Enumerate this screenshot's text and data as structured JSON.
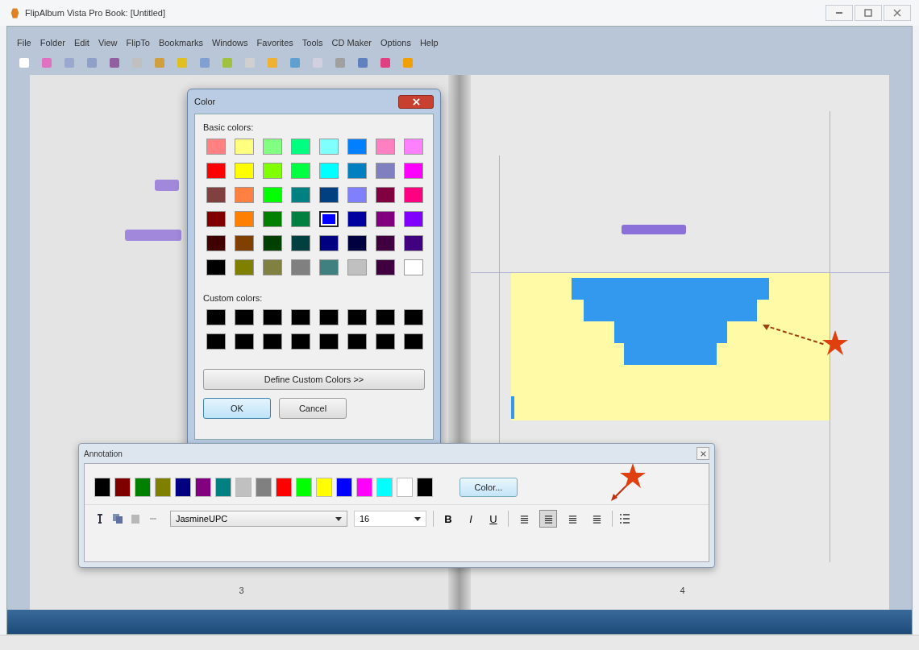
{
  "window": {
    "title": "FlipAlbum Vista Pro   Book: [Untitled]"
  },
  "menu": [
    "File",
    "Folder",
    "Edit",
    "View",
    "FlipTo",
    "Bookmarks",
    "Windows",
    "Favorites",
    "Tools",
    "CD Maker",
    "Options",
    "Help"
  ],
  "pages": {
    "left_number": "3",
    "right_number": "4"
  },
  "color_dialog": {
    "title": "Color",
    "basic_label": "Basic colors:",
    "custom_label": "Custom colors:",
    "define_button": "Define Custom Colors >>",
    "ok": "OK",
    "cancel": "Cancel",
    "basic_colors": [
      {
        "color": "#ff8080",
        "selected": false
      },
      {
        "color": "#ffff80",
        "selected": false
      },
      {
        "color": "#80ff80",
        "selected": false
      },
      {
        "color": "#00ff80",
        "selected": false
      },
      {
        "color": "#80ffff",
        "selected": false
      },
      {
        "color": "#0080ff",
        "selected": false
      },
      {
        "color": "#ff80c0",
        "selected": false
      },
      {
        "color": "#ff80ff",
        "selected": false
      },
      {
        "color": "#ff0000",
        "selected": false
      },
      {
        "color": "#ffff00",
        "selected": false
      },
      {
        "color": "#80ff00",
        "selected": false
      },
      {
        "color": "#00ff40",
        "selected": false
      },
      {
        "color": "#00ffff",
        "selected": false
      },
      {
        "color": "#0080c0",
        "selected": false
      },
      {
        "color": "#8080c0",
        "selected": false
      },
      {
        "color": "#ff00ff",
        "selected": false
      },
      {
        "color": "#804040",
        "selected": false
      },
      {
        "color": "#ff8040",
        "selected": false
      },
      {
        "color": "#00ff00",
        "selected": false
      },
      {
        "color": "#008080",
        "selected": false
      },
      {
        "color": "#004080",
        "selected": false
      },
      {
        "color": "#8080ff",
        "selected": false
      },
      {
        "color": "#800040",
        "selected": false
      },
      {
        "color": "#ff0080",
        "selected": false
      },
      {
        "color": "#800000",
        "selected": false
      },
      {
        "color": "#ff8000",
        "selected": false
      },
      {
        "color": "#008000",
        "selected": false
      },
      {
        "color": "#008040",
        "selected": false
      },
      {
        "color": "#0000ff",
        "selected": true
      },
      {
        "color": "#0000a0",
        "selected": false
      },
      {
        "color": "#800080",
        "selected": false
      },
      {
        "color": "#8000ff",
        "selected": false
      },
      {
        "color": "#400000",
        "selected": false
      },
      {
        "color": "#804000",
        "selected": false
      },
      {
        "color": "#004000",
        "selected": false
      },
      {
        "color": "#004040",
        "selected": false
      },
      {
        "color": "#000080",
        "selected": false
      },
      {
        "color": "#000040",
        "selected": false
      },
      {
        "color": "#400040",
        "selected": false
      },
      {
        "color": "#400080",
        "selected": false
      },
      {
        "color": "#000000",
        "selected": false
      },
      {
        "color": "#808000",
        "selected": false
      },
      {
        "color": "#808040",
        "selected": false
      },
      {
        "color": "#808080",
        "selected": false
      },
      {
        "color": "#408080",
        "selected": false
      },
      {
        "color": "#c0c0c0",
        "selected": false
      },
      {
        "color": "#400040",
        "selected": false
      },
      {
        "color": "#ffffff",
        "selected": false
      }
    ],
    "custom_colors": [
      {
        "color": "#000000"
      },
      {
        "color": "#000000"
      },
      {
        "color": "#000000"
      },
      {
        "color": "#000000"
      },
      {
        "color": "#000000"
      },
      {
        "color": "#000000"
      },
      {
        "color": "#000000"
      },
      {
        "color": "#000000"
      },
      {
        "color": "#000000"
      },
      {
        "color": "#000000"
      },
      {
        "color": "#000000"
      },
      {
        "color": "#000000"
      },
      {
        "color": "#000000"
      },
      {
        "color": "#000000"
      },
      {
        "color": "#000000"
      },
      {
        "color": "#000000"
      }
    ]
  },
  "annotation": {
    "title": "Annotation",
    "color_button": "Color...",
    "font": "JasmineUPC",
    "size": "16",
    "palette": [
      {
        "color": "#000000"
      },
      {
        "color": "#800000"
      },
      {
        "color": "#008000"
      },
      {
        "color": "#808000"
      },
      {
        "color": "#000080"
      },
      {
        "color": "#800080"
      },
      {
        "color": "#008080"
      },
      {
        "color": "#c0c0c0"
      },
      {
        "color": "#808080"
      },
      {
        "color": "#ff0000"
      },
      {
        "color": "#00ff00"
      },
      {
        "color": "#ffff00"
      },
      {
        "color": "#0000ff"
      },
      {
        "color": "#ff00ff"
      },
      {
        "color": "#00ffff"
      },
      {
        "color": "#ffffff"
      },
      {
        "color": "#000000"
      }
    ],
    "style_buttons": [
      {
        "label": "B",
        "kind": "bold"
      },
      {
        "label": "I",
        "kind": "italic"
      },
      {
        "label": "U",
        "kind": "underline"
      }
    ],
    "align_buttons": [
      {
        "selected": false
      },
      {
        "selected": true
      },
      {
        "selected": false
      },
      {
        "selected": false
      }
    ]
  }
}
